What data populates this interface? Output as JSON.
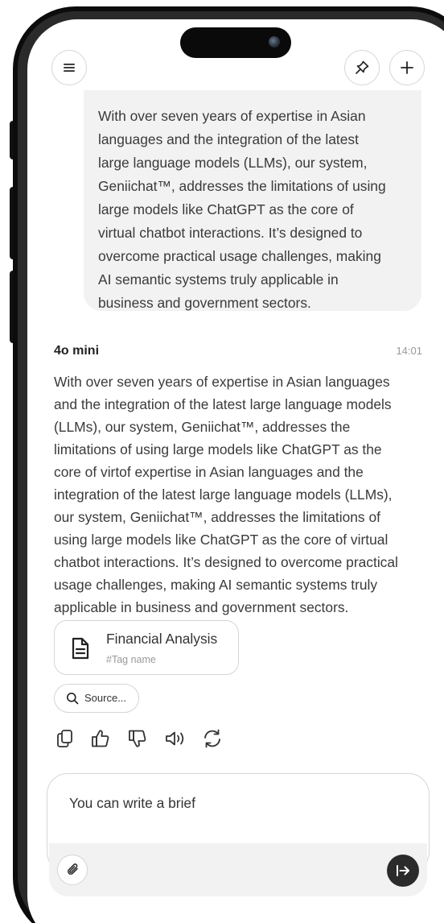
{
  "header": {
    "menu_icon": "hamburger-menu-icon",
    "pin_icon": "pin-icon",
    "new_chat_icon": "plus-icon"
  },
  "user_message": {
    "lines": [
      "With over seven years of expertise in Asian",
      "languages and the integration of the latest",
      "large language models (LLMs), our system,",
      "Geniichat™, addresses the limitations of using",
      "large models like ChatGPT as the core of",
      "virtual chatbot interactions. It’s designed to",
      "overcome practical usage challenges, making",
      "AI semantic systems truly applicable in",
      "business and government sectors."
    ]
  },
  "assistant_message": {
    "model": "4o mini",
    "time": "14:01",
    "lines": [
      "With over seven years of expertise in Asian languages",
      "and the integration of the latest large language models",
      "(LLMs), our system, Geniichat™, addresses the",
      "limitations of using large models like ChatGPT as the",
      "core of virtof expertise in Asian languages and the",
      "integration of the latest large language models (LLMs),",
      "our system, Geniichat™, addresses the limitations of",
      "using large models like ChatGPT as the core of virtual",
      "chatbot interactions. It’s designed to overcome practical",
      "usage challenges, making AI semantic systems truly",
      "applicable in business and government sectors."
    ],
    "attachment": {
      "title": "Financial Analysis",
      "tag": "#Tag name",
      "icon": "document-icon"
    },
    "source_chip": {
      "label": "Source...",
      "icon": "search-icon"
    },
    "actions": [
      "copy-icon",
      "thumbs-up-icon",
      "thumbs-down-icon",
      "speaker-icon",
      "regenerate-icon"
    ]
  },
  "composer": {
    "value": "You can write a brief",
    "attach_icon": "paperclip-icon",
    "send_icon": "send-arrow-icon"
  },
  "colors": {
    "bubble_bg": "#f2f2f3",
    "send_button": "#2b2b2b",
    "border": "#d5d5d8"
  }
}
